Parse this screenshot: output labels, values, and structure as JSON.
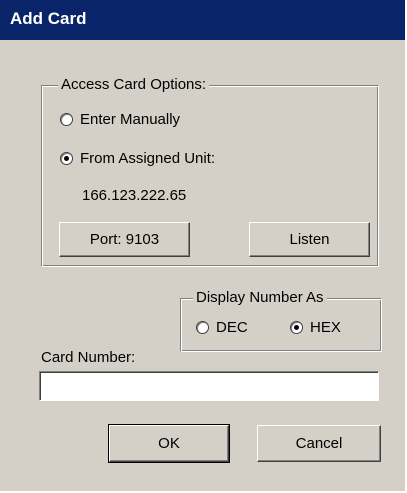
{
  "window": {
    "title": "Add Card"
  },
  "access_card_options": {
    "legend": "Access Card Options:",
    "options": [
      {
        "label": "Enter Manually",
        "checked": false
      },
      {
        "label": "From Assigned Unit:",
        "checked": true
      }
    ],
    "unit_address": "166.123.222.65",
    "port_button_label": "Port: 9103",
    "listen_button_label": "Listen"
  },
  "display_number_as": {
    "legend": "Display Number As",
    "options": [
      {
        "label": "DEC",
        "checked": false
      },
      {
        "label": "HEX",
        "checked": true
      }
    ]
  },
  "card_number": {
    "label": "Card Number:",
    "value": ""
  },
  "footer": {
    "ok_label": "OK",
    "cancel_label": "Cancel"
  }
}
